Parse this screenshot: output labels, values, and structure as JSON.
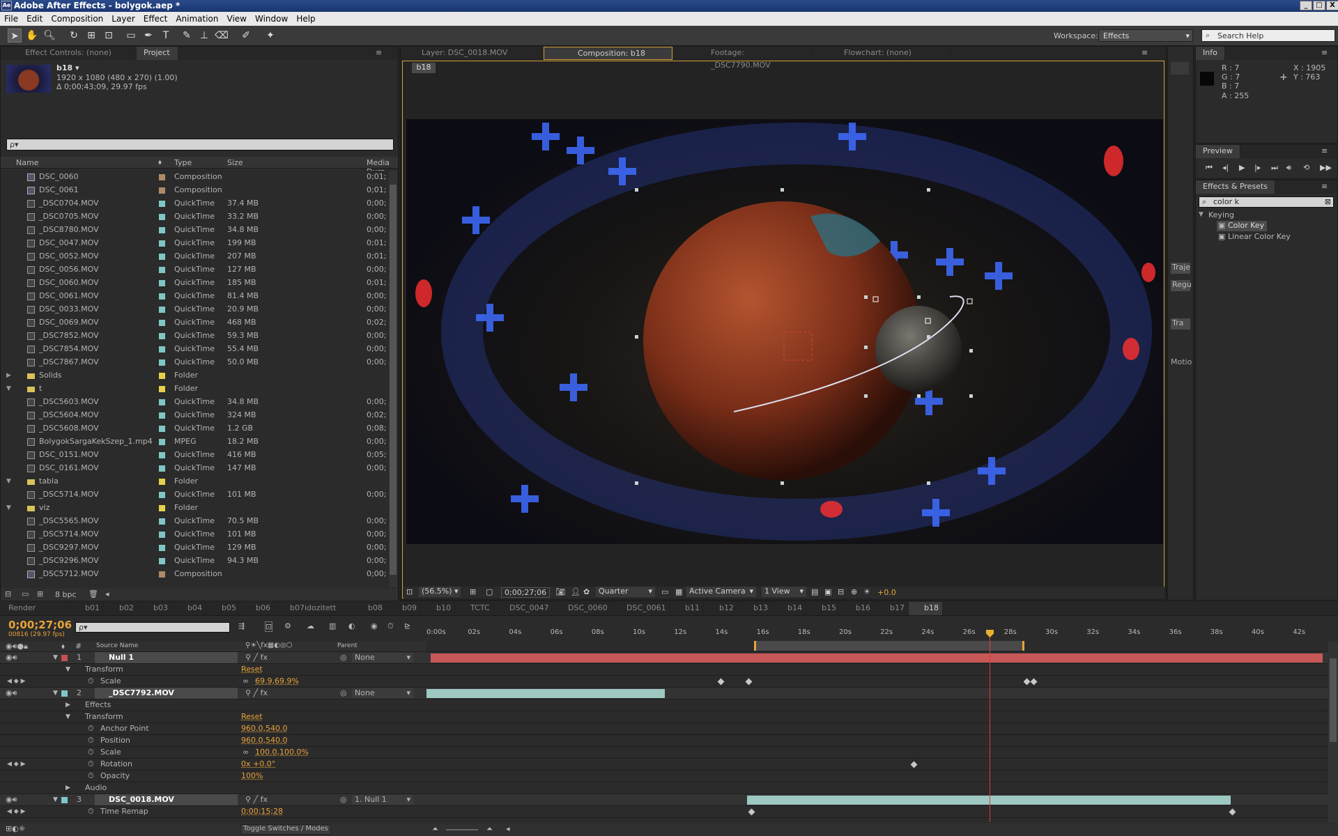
{
  "window": {
    "title": "Adobe After Effects - bolygok.aep *",
    "app_badge": "Ae",
    "min": "_",
    "max": "□",
    "close": "X"
  },
  "menu": [
    "File",
    "Edit",
    "Composition",
    "Layer",
    "Effect",
    "Animation",
    "View",
    "Window",
    "Help"
  ],
  "toolbar": {
    "workspace_label": "Workspace:",
    "workspace_value": "Effects",
    "search_help_placeholder": "Search Help"
  },
  "project_panel": {
    "tabs": [
      "Effect Controls: (none)",
      "Project"
    ],
    "comp_name": "b18 ▾",
    "comp_size": "1920 x 1080  (480 x 270) (1.00)",
    "comp_duration": "Δ 0;00;43;09, 29.97 fps",
    "search_placeholder": "ρ▾",
    "columns": [
      "Name",
      "Type",
      "Size",
      "Media Dura"
    ],
    "rows": [
      {
        "tw": "",
        "name": "DSC_0060",
        "color": "#b08a65",
        "type": "Composition",
        "size": "",
        "dur": "0;01;",
        "kind": "comp"
      },
      {
        "tw": "",
        "name": "DSC_0061",
        "color": "#b08a65",
        "type": "Composition",
        "size": "",
        "dur": "0;01;",
        "kind": "comp"
      },
      {
        "tw": "",
        "name": "_DSC0704.MOV",
        "color": "#7fc7c7",
        "type": "QuickTime",
        "size": "37.4 MB",
        "dur": "0;00;",
        "kind": "file"
      },
      {
        "tw": "",
        "name": "_DSC0705.MOV",
        "color": "#7fc7c7",
        "type": "QuickTime",
        "size": "33.2 MB",
        "dur": "0;00;",
        "kind": "file"
      },
      {
        "tw": "",
        "name": "_DSC8780.MOV",
        "color": "#7fc7c7",
        "type": "QuickTime",
        "size": "34.8 MB",
        "dur": "0;00;",
        "kind": "file"
      },
      {
        "tw": "",
        "name": "DSC_0047.MOV",
        "color": "#7fc7c7",
        "type": "QuickTime",
        "size": "199 MB",
        "dur": "0;01;",
        "kind": "file"
      },
      {
        "tw": "",
        "name": "DSC_0052.MOV",
        "color": "#7fc7c7",
        "type": "QuickTime",
        "size": "207 MB",
        "dur": "0;01;",
        "kind": "file"
      },
      {
        "tw": "",
        "name": "DSC_0056.MOV",
        "color": "#7fc7c7",
        "type": "QuickTime",
        "size": "127 MB",
        "dur": "0;00;",
        "kind": "file"
      },
      {
        "tw": "",
        "name": "DSC_0060.MOV",
        "color": "#7fc7c7",
        "type": "QuickTime",
        "size": "185 MB",
        "dur": "0;01;",
        "kind": "file"
      },
      {
        "tw": "",
        "name": "DSC_0061.MOV",
        "color": "#7fc7c7",
        "type": "QuickTime",
        "size": "81.4 MB",
        "dur": "0;00;",
        "kind": "file"
      },
      {
        "tw": "",
        "name": "DSC_0033.MOV",
        "color": "#7fc7c7",
        "type": "QuickTime",
        "size": "20.9 MB",
        "dur": "0;00;",
        "kind": "file"
      },
      {
        "tw": "",
        "name": "DSC_0069.MOV",
        "color": "#7fc7c7",
        "type": "QuickTime",
        "size": "468 MB",
        "dur": "0;02;",
        "kind": "file"
      },
      {
        "tw": "",
        "name": "_DSC7852.MOV",
        "color": "#7fc7c7",
        "type": "QuickTime",
        "size": "59.3 MB",
        "dur": "0;00;",
        "kind": "file"
      },
      {
        "tw": "",
        "name": "_DSC7854.MOV",
        "color": "#7fc7c7",
        "type": "QuickTime",
        "size": "55.4 MB",
        "dur": "0;00;",
        "kind": "file"
      },
      {
        "tw": "",
        "name": "_DSC7867.MOV",
        "color": "#7fc7c7",
        "type": "QuickTime",
        "size": "50.0 MB",
        "dur": "0;00;",
        "kind": "file"
      },
      {
        "tw": "▶",
        "name": "Solids",
        "color": "#e6cf4a",
        "type": "Folder",
        "size": "",
        "dur": "",
        "kind": "fold"
      },
      {
        "tw": "▼",
        "name": "t",
        "color": "#e6cf4a",
        "type": "Folder",
        "size": "",
        "dur": "",
        "kind": "fold"
      },
      {
        "tw": "",
        "name": "_DSC5603.MOV",
        "color": "#7fc7c7",
        "type": "QuickTime",
        "size": "34.8 MB",
        "dur": "0;00;",
        "kind": "file"
      },
      {
        "tw": "",
        "name": "_DSC5604.MOV",
        "color": "#7fc7c7",
        "type": "QuickTime",
        "size": "324 MB",
        "dur": "0;02;",
        "kind": "file"
      },
      {
        "tw": "",
        "name": "_DSC5608.MOV",
        "color": "#7fc7c7",
        "type": "QuickTime",
        "size": "1.2 GB",
        "dur": "0;08;",
        "kind": "file"
      },
      {
        "tw": "",
        "name": "BolygokSargaKekSzep_1.mp4",
        "color": "#7fc7c7",
        "type": "MPEG",
        "size": "18.2 MB",
        "dur": "0;00;",
        "kind": "file"
      },
      {
        "tw": "",
        "name": "DSC_0151.MOV",
        "color": "#7fc7c7",
        "type": "QuickTime",
        "size": "416 MB",
        "dur": "0;05;",
        "kind": "file"
      },
      {
        "tw": "",
        "name": "DSC_0161.MOV",
        "color": "#7fc7c7",
        "type": "QuickTime",
        "size": "147 MB",
        "dur": "0;00;",
        "kind": "file"
      },
      {
        "tw": "▼",
        "name": "tabla",
        "color": "#e6cf4a",
        "type": "Folder",
        "size": "",
        "dur": "",
        "kind": "fold"
      },
      {
        "tw": "",
        "name": "_DSC5714.MOV",
        "color": "#7fc7c7",
        "type": "QuickTime",
        "size": "101 MB",
        "dur": "0;00;",
        "kind": "file"
      },
      {
        "tw": "▼",
        "name": "viz",
        "color": "#e6cf4a",
        "type": "Folder",
        "size": "",
        "dur": "",
        "kind": "fold"
      },
      {
        "tw": "",
        "name": "_DSC5565.MOV",
        "color": "#7fc7c7",
        "type": "QuickTime",
        "size": "70.5 MB",
        "dur": "0;00;",
        "kind": "file"
      },
      {
        "tw": "",
        "name": "_DSC5714.MOV",
        "color": "#7fc7c7",
        "type": "QuickTime",
        "size": "101 MB",
        "dur": "0;00;",
        "kind": "file"
      },
      {
        "tw": "",
        "name": "_DSC9297.MOV",
        "color": "#7fc7c7",
        "type": "QuickTime",
        "size": "129 MB",
        "dur": "0;00;",
        "kind": "file"
      },
      {
        "tw": "",
        "name": "_DSC9296.MOV",
        "color": "#7fc7c7",
        "type": "QuickTime",
        "size": "94.3 MB",
        "dur": "0;00;",
        "kind": "file"
      },
      {
        "tw": "",
        "name": "_DSC5712.MOV",
        "color": "#b08a65",
        "type": "Composition",
        "size": "",
        "dur": "0;00;",
        "kind": "comp"
      }
    ],
    "bpc": "8 bpc"
  },
  "viewer": {
    "tabs": [
      "Layer: DSC_0018.MOV",
      "Composition: b18",
      "Footage: _DSC7790.MOV",
      "Flowchart: (none)"
    ],
    "comp_chip": "b18",
    "zoom": "(56.5%)",
    "timecode": "0;00;27;06",
    "resolution": "Quarter",
    "camera": "Active Camera",
    "views": "1 View",
    "exposure": "+0.0"
  },
  "info_panel": {
    "title": "Info",
    "r": "R : 7",
    "g": "G : 7",
    "b": "B : 7",
    "a": "A : 255",
    "x": "X : 1905",
    "y": "Y : 763"
  },
  "preview_panel": {
    "title": "Preview"
  },
  "effects_panel": {
    "title": "Effects & Presets",
    "search": "color k",
    "category": "Keying",
    "items": [
      "Color Key",
      "Linear Color Key"
    ]
  },
  "side_strip": {
    "labels": [
      "Traje",
      "Regu",
      "Tra",
      "Motio"
    ]
  },
  "timeline": {
    "tabs": [
      "Render Queue",
      "b01",
      "b02",
      "b03",
      "b04",
      "b05",
      "b06",
      "b07idozitett",
      "b08",
      "b09",
      "b10",
      "TCTC",
      "DSC_0047",
      "DSC_0060",
      "DSC_0061",
      "b11",
      "b12",
      "b13",
      "b14",
      "b15",
      "b16",
      "b17",
      "b18"
    ],
    "timecode": "0;00;27;06",
    "frames": "00816 (29.97 fps)",
    "search_placeholder": "ρ▾",
    "col_source": "Source Name",
    "col_parent": "Parent",
    "ruler": [
      "0:00s",
      "02s",
      "04s",
      "06s",
      "08s",
      "10s",
      "12s",
      "14s",
      "16s",
      "18s",
      "20s",
      "22s",
      "24s",
      "26s",
      "28s",
      "30s",
      "32s",
      "34s",
      "36s",
      "38s",
      "40s",
      "42s"
    ],
    "rows": [
      {
        "indent": 0,
        "num": "1",
        "label": "Null 1",
        "layer": true,
        "color": "#c85050",
        "parent": "None",
        "sw": "fx-none",
        "bar": "red"
      },
      {
        "indent": 1,
        "label": "Transform",
        "value": "Reset",
        "tw": "▼"
      },
      {
        "indent": 2,
        "label": "Scale",
        "value": "69.9,69.9%",
        "link": true,
        "kf": true
      },
      {
        "indent": 0,
        "num": "2",
        "label": "_DSC7792.MOV",
        "layer": true,
        "color": "#7fc7c7",
        "parent": "None",
        "bar": "teal1"
      },
      {
        "indent": 1,
        "label": "Effects",
        "tw": "▶"
      },
      {
        "indent": 1,
        "label": "Transform",
        "value": "Reset",
        "tw": "▼"
      },
      {
        "indent": 2,
        "label": "Anchor Point",
        "value": "960.0,540.0"
      },
      {
        "indent": 2,
        "label": "Position",
        "value": "960.0,540.0"
      },
      {
        "indent": 2,
        "label": "Scale",
        "value": "100.0,100.0%",
        "link": true
      },
      {
        "indent": 2,
        "label": "Rotation",
        "value": "0x +0.0°",
        "kf": true
      },
      {
        "indent": 2,
        "label": "Opacity",
        "value": "100%"
      },
      {
        "indent": 1,
        "label": "Audio",
        "tw": "▶"
      },
      {
        "indent": 0,
        "num": "3",
        "label": "DSC_0018.MOV",
        "layer": true,
        "color": "#7fc7c7",
        "parent": "1. Null 1",
        "bar": "teal2"
      },
      {
        "indent": 2,
        "label": "Time Remap",
        "value": "0;00;15;28",
        "kf": true
      }
    ],
    "toggle_label": "Toggle Switches / Modes"
  }
}
